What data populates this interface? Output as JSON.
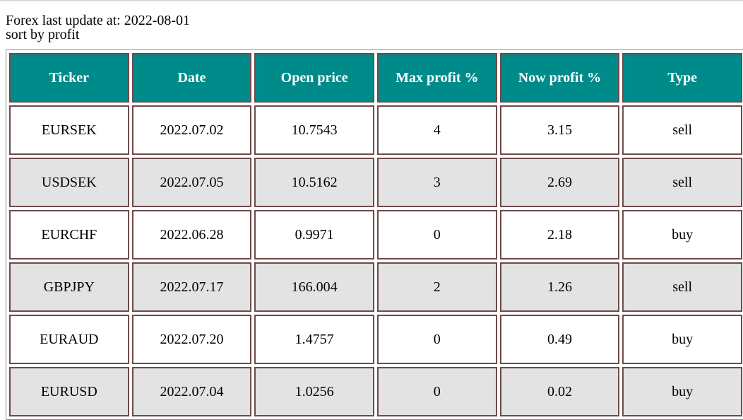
{
  "header": {
    "update_label": "Forex last update at: 2022-08-01",
    "sort_label": "sort by profit"
  },
  "table": {
    "columns": [
      "Ticker",
      "Date",
      "Open price",
      "Max profit %",
      "Now profit %",
      "Type"
    ],
    "rows": [
      [
        "EURSEK",
        "2022.07.02",
        "10.7543",
        "4",
        "3.15",
        "sell"
      ],
      [
        "USDSEK",
        "2022.07.05",
        "10.5162",
        "3",
        "2.69",
        "sell"
      ],
      [
        "EURCHF",
        "2022.06.28",
        "0.9971",
        "0",
        "2.18",
        "buy"
      ],
      [
        "GBPJPY",
        "2022.07.17",
        "166.004",
        "2",
        "1.26",
        "sell"
      ],
      [
        "EURAUD",
        "2022.07.20",
        "1.4757",
        "0",
        "0.49",
        "buy"
      ],
      [
        "EURUSD",
        "2022.07.04",
        "1.0256",
        "0",
        "0.02",
        "buy"
      ]
    ]
  },
  "colors": {
    "header_bg": "#008b8b",
    "header_text": "#ffffff",
    "row_alt_bg": "#e3e3e3",
    "cell_border": "#6e4a4a"
  }
}
